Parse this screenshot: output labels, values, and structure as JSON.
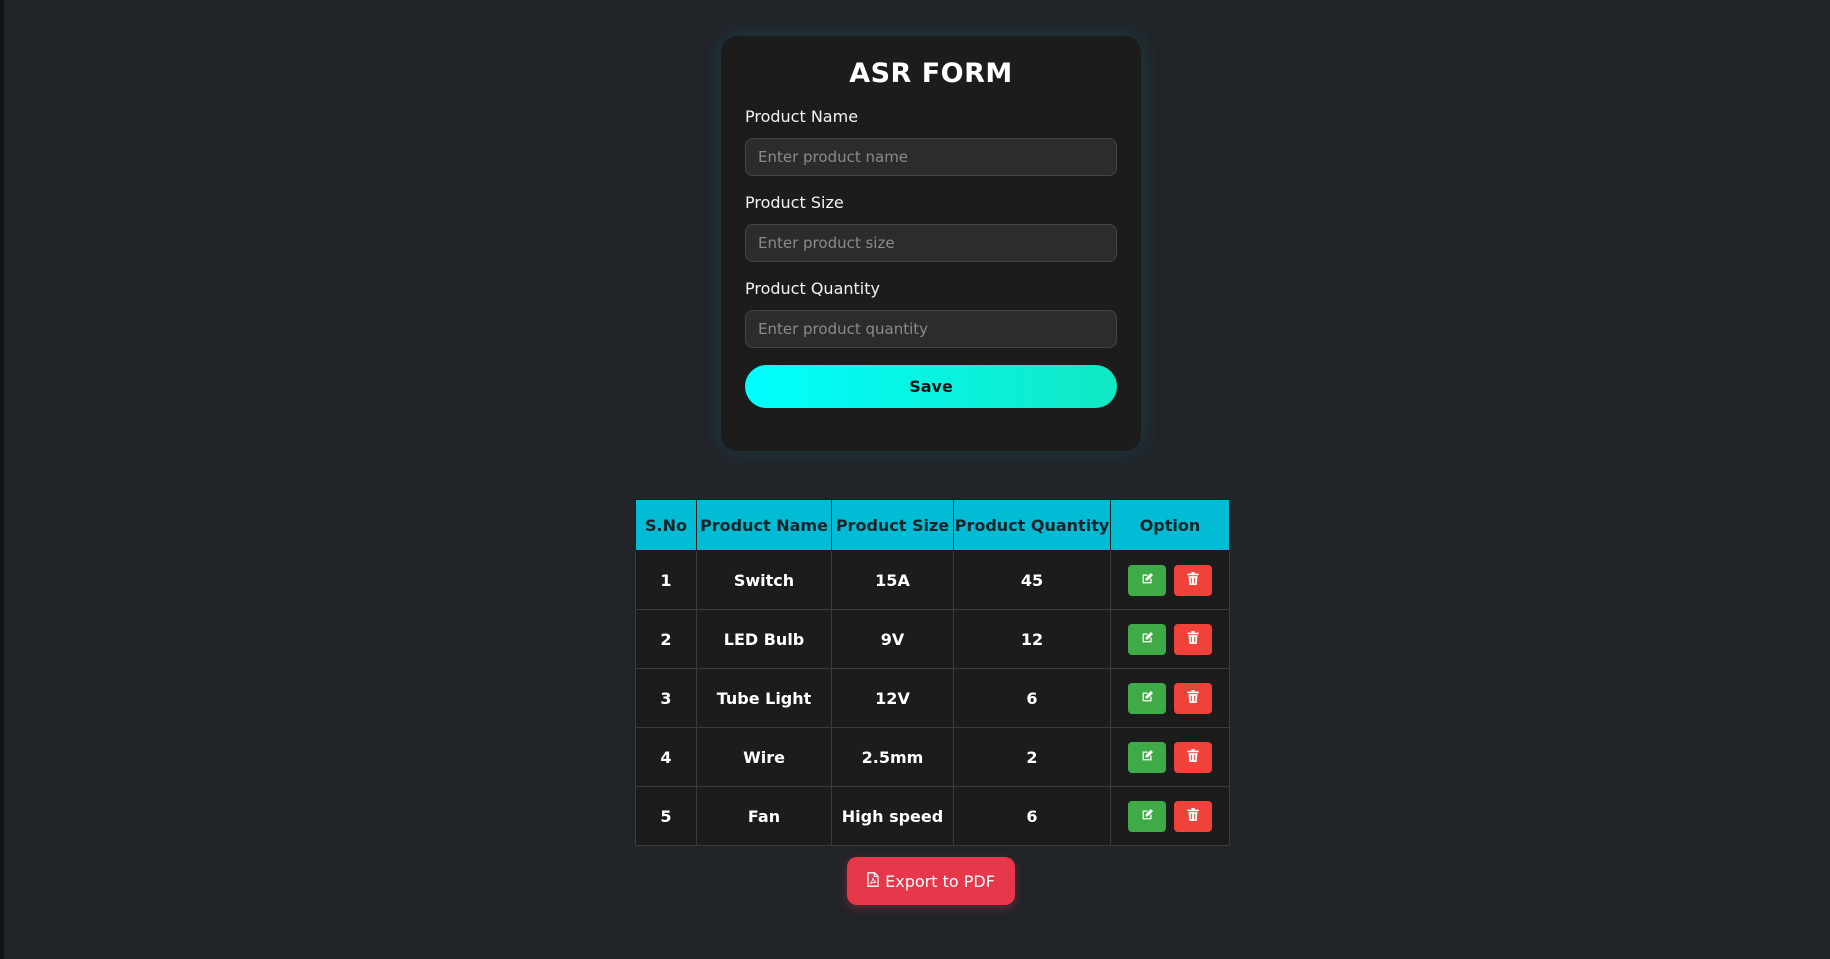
{
  "form": {
    "title": "ASR FORM",
    "fields": [
      {
        "label": "Product Name",
        "placeholder": "Enter product name",
        "value": ""
      },
      {
        "label": "Product Size",
        "placeholder": "Enter product size",
        "value": ""
      },
      {
        "label": "Product Quantity",
        "placeholder": "Enter product quantity",
        "value": ""
      }
    ],
    "save_label": "Save"
  },
  "table": {
    "headers": [
      "S.No",
      "Product Name",
      "Product Size",
      "Product Quantity",
      "Option"
    ],
    "rows": [
      {
        "sno": "1",
        "name": "Switch",
        "size": "15A",
        "quantity": "45"
      },
      {
        "sno": "2",
        "name": "LED Bulb",
        "size": "9V",
        "quantity": "12"
      },
      {
        "sno": "3",
        "name": "Tube Light",
        "size": "12V",
        "quantity": "6"
      },
      {
        "sno": "4",
        "name": "Wire",
        "size": "2.5mm",
        "quantity": "2"
      },
      {
        "sno": "5",
        "name": "Fan",
        "size": "High speed",
        "quantity": "6"
      }
    ],
    "row_actions": {
      "edit_icon": "edit-icon",
      "delete_icon": "trash-icon"
    }
  },
  "export": {
    "label": "Export to PDF",
    "icon": "file-pdf-icon"
  },
  "colors": {
    "background": "#212429",
    "card": "#1c1c1c",
    "header": "#02bcd6",
    "save_gradient_start": "#00ffff",
    "save_gradient_end": "#11e8c4",
    "edit": "#3fab47",
    "delete": "#f0413a",
    "export": "#e6374b"
  }
}
